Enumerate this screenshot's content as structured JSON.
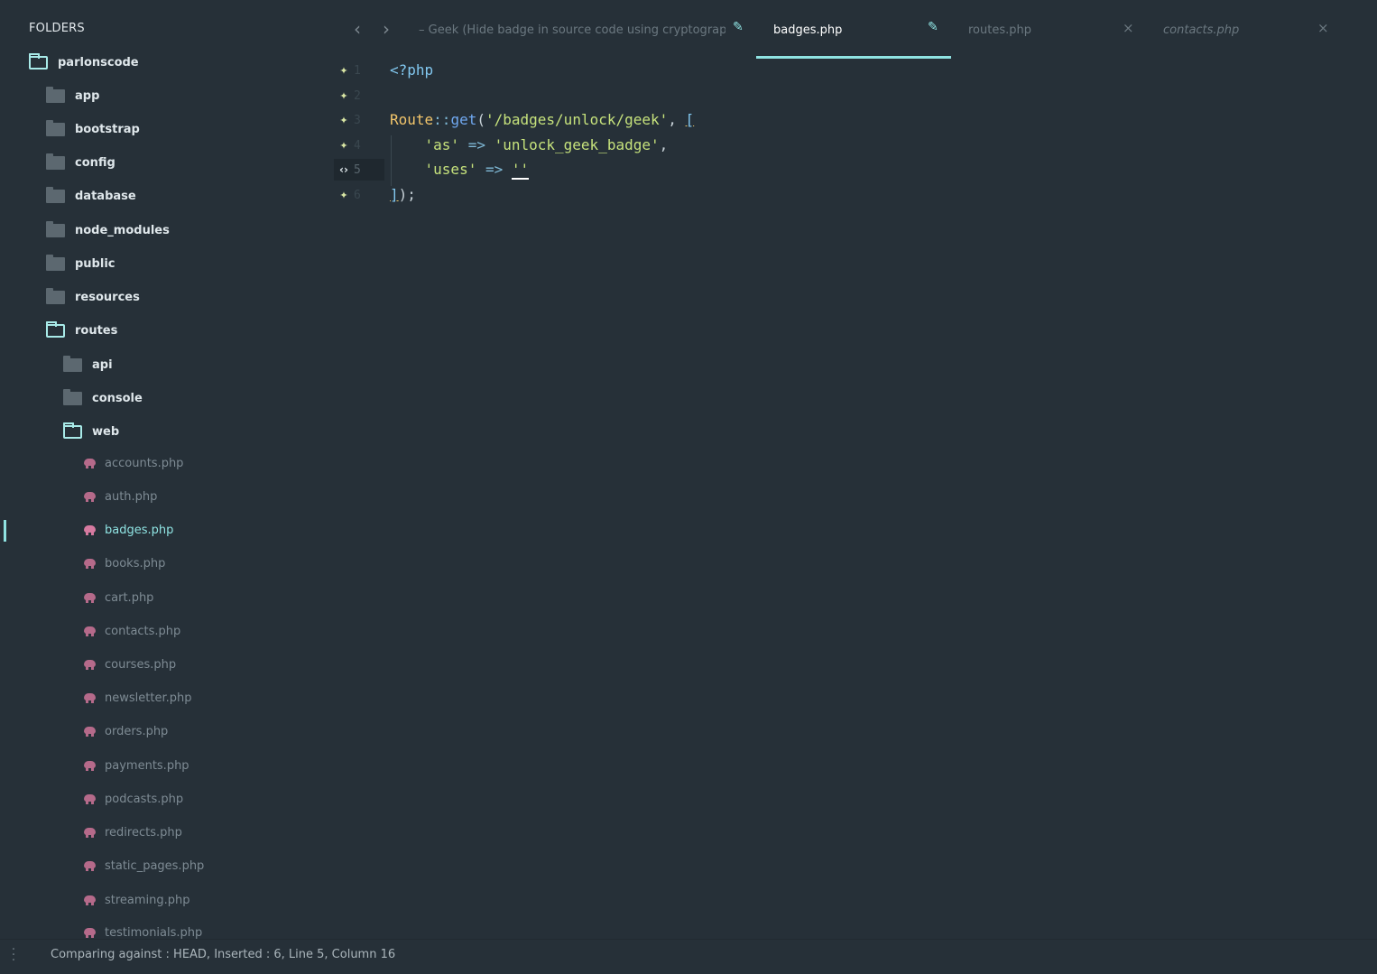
{
  "sidebar": {
    "header": "FOLDERS",
    "root": "parlonscode",
    "folders": [
      "app",
      "bootstrap",
      "config",
      "database",
      "node_modules",
      "public",
      "resources"
    ],
    "routes": "routes",
    "routes_children": [
      "api",
      "console"
    ],
    "web": "web",
    "web_files": [
      "accounts.php",
      "auth.php",
      "badges.php",
      "books.php",
      "cart.php",
      "contacts.php",
      "courses.php",
      "newsletter.php",
      "orders.php",
      "payments.php",
      "podcasts.php",
      "redirects.php",
      "static_pages.php",
      "streaming.php",
      "testimonials.php"
    ],
    "active_file": "badges.php"
  },
  "tabs": [
    {
      "label": "– Geek (Hide badge in source code using cryptograp",
      "icon": "pencil-icon",
      "state": "modified"
    },
    {
      "label": "badges.php",
      "icon": "pencil-icon",
      "state": "active-modified"
    },
    {
      "label": "routes.php",
      "icon": "close-icon",
      "state": "normal"
    },
    {
      "label": "contacts.php",
      "icon": "close-icon",
      "state": "preview"
    }
  ],
  "nav": {
    "back": "‹",
    "forward": "›"
  },
  "editor": {
    "line_numbers": [
      "1",
      "2",
      "3",
      "4",
      "5",
      "6"
    ],
    "current_line": 5,
    "gutter_marks": [
      "✦",
      "✦",
      "✦",
      "✦",
      "‹›",
      "✦"
    ],
    "lines": {
      "l1": {
        "tag": "<?php"
      },
      "l3": {
        "class": "Route",
        "sep": "::",
        "func": "get",
        "open": "(",
        "path": "'/badges/unlock/geek'",
        "comma": ", ",
        "bracket": "["
      },
      "l4": {
        "key": "'as'",
        "arrow": " => ",
        "val": "'unlock_geek_badge'",
        "comma": ","
      },
      "l5": {
        "key": "'uses'",
        "arrow": " => ",
        "val": "''"
      },
      "l6": {
        "bracket": "]",
        "rest": ");"
      }
    }
  },
  "status": {
    "text": "Comparing against : HEAD, Inserted : 6, Line 5, Column 16",
    "menu_icon": "⋮"
  },
  "colors": {
    "accent": "#8fe3e2",
    "background": "#263038",
    "string": "#c6e27c",
    "class": "#f2c56b"
  }
}
